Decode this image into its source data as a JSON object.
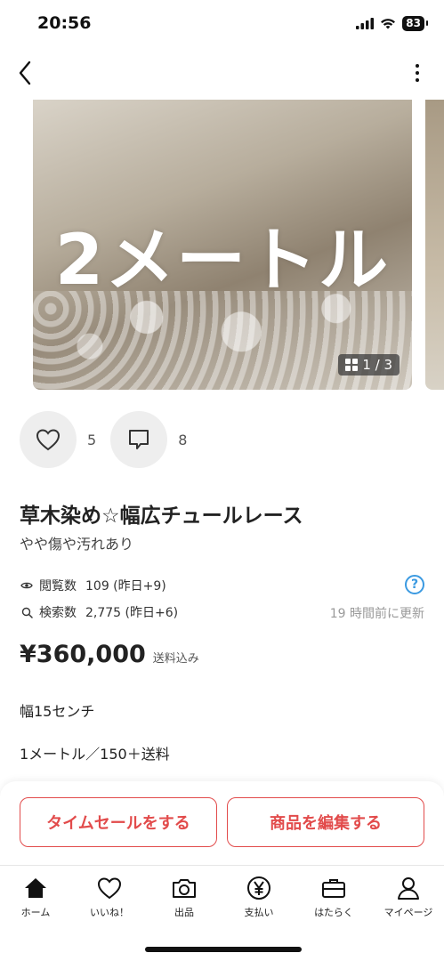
{
  "status_bar": {
    "time": "20:56",
    "battery": "83"
  },
  "gallery": {
    "overlay_text": "2メートル",
    "counter": "1 / 3"
  },
  "reactions": {
    "likes": "5",
    "comments": "8"
  },
  "item": {
    "title": "草木染め☆幅広チュールレース",
    "condition": "やや傷や汚れあり",
    "views_label": "閲覧数",
    "views_value": "109 (昨日+9)",
    "search_label": "検索数",
    "search_value": "2,775 (昨日+6)",
    "updated": "19 時間前に更新",
    "price": "¥360,000",
    "shipping": "送料込み",
    "description": [
      "幅15センチ",
      "1メートル／150＋送料"
    ]
  },
  "actions": {
    "timesale": "タイムセールをする",
    "edit": "商品を編集する"
  },
  "tabs": [
    {
      "label": "ホーム",
      "icon": "home-icon"
    },
    {
      "label": "いいね！",
      "icon": "heart-icon"
    },
    {
      "label": "出品",
      "icon": "camera-icon"
    },
    {
      "label": "支払い",
      "icon": "yen-icon"
    },
    {
      "label": "はたらく",
      "icon": "briefcase-icon"
    },
    {
      "label": "マイページ",
      "icon": "person-icon"
    }
  ],
  "colors": {
    "accent": "#e24b4b",
    "help": "#3b9ae1"
  }
}
